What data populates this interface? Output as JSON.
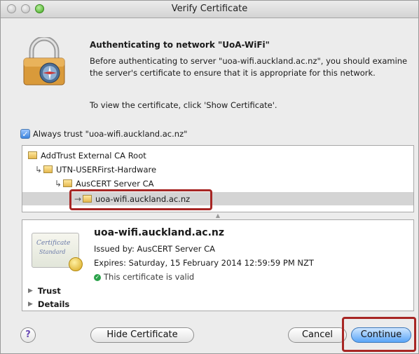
{
  "window": {
    "title": "Verify Certificate"
  },
  "header": {
    "title": "Authenticating to network \"UoA-WiFi\"",
    "body": "Before authenticating to server \"uoa-wifi.auckland.ac.nz\", you should examine the server's certificate to ensure that it is appropriate for this network.",
    "hint": "To view the certificate, click 'Show Certificate'."
  },
  "trust": {
    "checked": true,
    "label": "Always trust \"uoa-wifi.auckland.ac.nz\""
  },
  "chain": [
    {
      "label": "AddTrust External CA Root"
    },
    {
      "label": "UTN-USERFirst-Hardware"
    },
    {
      "label": "AusCERT Server CA"
    },
    {
      "label": "uoa-wifi.auckland.ac.nz",
      "selected": true
    }
  ],
  "certificate": {
    "image_text_1": "Certificate",
    "image_text_2": "Standard",
    "name": "uoa-wifi.auckland.ac.nz",
    "issued_by": "Issued by: AusCERT Server CA",
    "expires": "Expires: Saturday, 15 February 2014 12:59:59 PM NZT",
    "status": "This certificate is valid",
    "sections": [
      "Trust",
      "Details"
    ]
  },
  "buttons": {
    "help": "?",
    "hide_certificate": "Hide Certificate",
    "cancel": "Cancel",
    "continue": "Continue"
  },
  "colors": {
    "highlight": "#a72624",
    "primary_button": "#5aa5f7",
    "valid": "#2aa24a"
  }
}
